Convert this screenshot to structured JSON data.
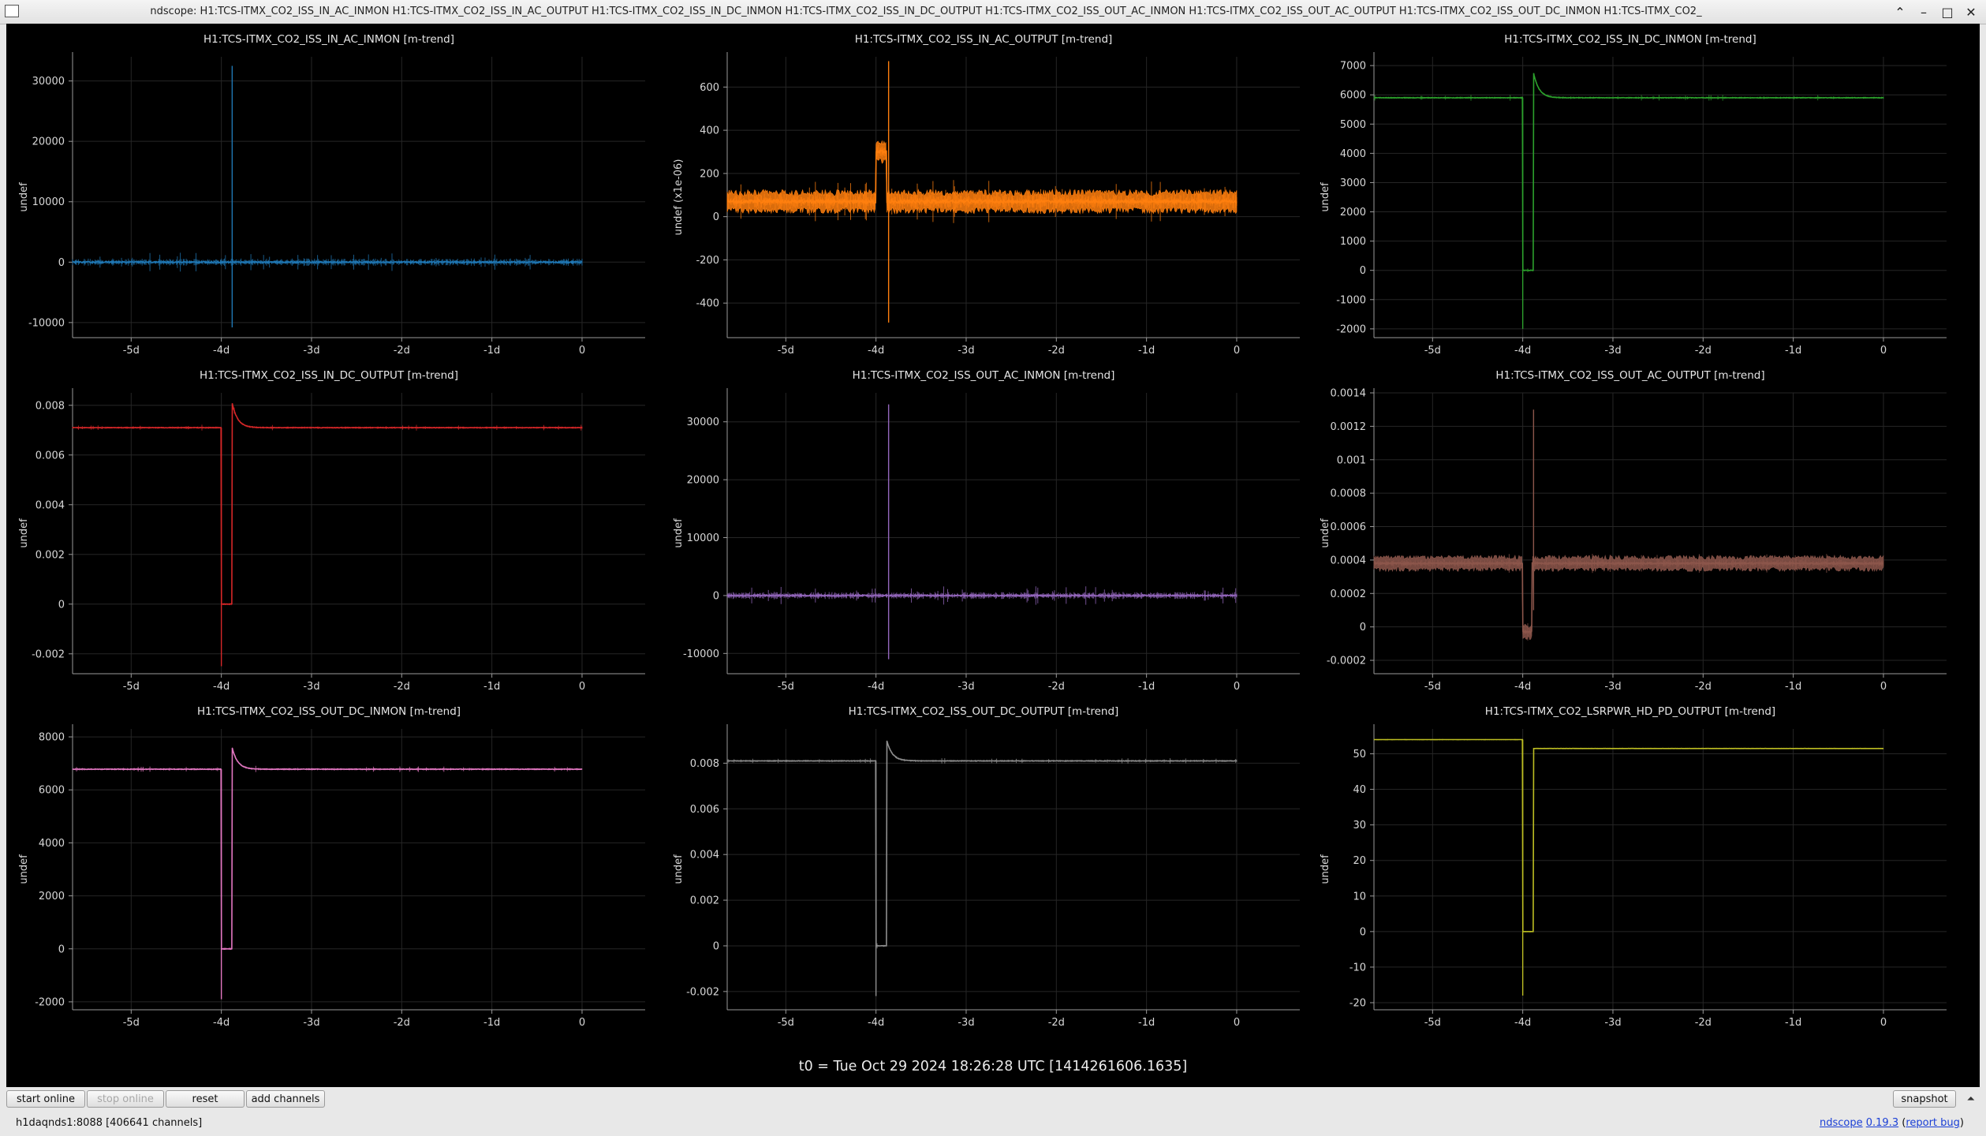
{
  "window": {
    "title": "ndscope: H1:TCS-ITMX_CO2_ISS_IN_AC_INMON H1:TCS-ITMX_CO2_ISS_IN_AC_OUTPUT H1:TCS-ITMX_CO2_ISS_IN_DC_INMON H1:TCS-ITMX_CO2_ISS_IN_DC_OUTPUT H1:TCS-ITMX_CO2_ISS_OUT_AC_INMON H1:TCS-ITMX_CO2_ISS_OUT_AC_OUTPUT H1:TCS-ITMX_CO2_ISS_OUT_DC_INMON H1:TCS-ITMX_CO2_",
    "controls": [
      "⌃",
      "–",
      "□",
      "✕"
    ]
  },
  "t0_label": "t0 = Tue Oct 29 2024 18:26:28 UTC [1414261606.1635]",
  "toolbar": {
    "start_online": "start online",
    "stop_online": "stop online",
    "reset": "reset",
    "add_channels": "add channels",
    "snapshot": "snapshot"
  },
  "status": "h1daqnds1:8088  [406641 channels]",
  "version": {
    "app": "ndscope",
    "number": "0.19.3",
    "report": "report bug"
  },
  "chart_data": [
    {
      "type": "line",
      "title": "H1:TCS-ITMX_CO2_ISS_IN_AC_INMON [m-trend]",
      "ylabel": "undef",
      "color": "#1f77b4",
      "xlim": [
        -5.65,
        0.7
      ],
      "ylim": [
        -12500,
        34000
      ],
      "x_ticks": [
        -5,
        -4,
        -3,
        -2,
        -1,
        0
      ],
      "x_tick_labels": [
        "-5d",
        "-4d",
        "-3d",
        "-2d",
        "-1d",
        "0"
      ],
      "y_ticks": [
        -10000,
        0,
        10000,
        20000,
        30000
      ],
      "y_tick_labels": [
        "-10000",
        "0",
        "10000",
        "20000",
        "30000"
      ],
      "series": [
        {
          "baseline": 0,
          "noise": 400,
          "band": 0,
          "events": [
            {
              "x": -3.88,
              "high": 32500,
              "low": -10800
            }
          ]
        }
      ]
    },
    {
      "type": "line",
      "title": "H1:TCS-ITMX_CO2_ISS_IN_AC_OUTPUT [m-trend]",
      "ylabel": "undef (x1e-06)",
      "color": "#ff7f0e",
      "xlim": [
        -5.65,
        0.7
      ],
      "ylim": [
        -560,
        740
      ],
      "x_ticks": [
        -5,
        -4,
        -3,
        -2,
        -1,
        0
      ],
      "x_tick_labels": [
        "-5d",
        "-4d",
        "-3d",
        "-2d",
        "-1d",
        "0"
      ],
      "y_ticks": [
        -400,
        -200,
        0,
        200,
        400,
        600
      ],
      "y_tick_labels": [
        "-400",
        "-200",
        "0",
        "200",
        "400",
        "600"
      ],
      "series": [
        {
          "baseline": 70,
          "noise": 25,
          "band": 35,
          "step": {
            "x0": -4.0,
            "x1": -3.88,
            "value": 300
          },
          "events": [
            {
              "x": -3.86,
              "high": 720,
              "low": -490
            }
          ]
        }
      ]
    },
    {
      "type": "line",
      "title": "H1:TCS-ITMX_CO2_ISS_IN_DC_INMON [m-trend]",
      "ylabel": "undef",
      "color": "#2ca02c",
      "xlim": [
        -5.65,
        0.7
      ],
      "ylim": [
        -2300,
        7300
      ],
      "x_ticks": [
        -5,
        -4,
        -3,
        -2,
        -1,
        0
      ],
      "x_tick_labels": [
        "-5d",
        "-4d",
        "-3d",
        "-2d",
        "-1d",
        "0"
      ],
      "y_ticks": [
        -2000,
        -1000,
        0,
        1000,
        2000,
        3000,
        4000,
        5000,
        6000,
        7000
      ],
      "y_tick_labels": [
        "-2000",
        "-1000",
        "0",
        "1000",
        "2000",
        "3000",
        "4000",
        "5000",
        "6000",
        "7000"
      ],
      "series": [
        {
          "baseline": 5900,
          "noise": 25,
          "band": 0,
          "step": {
            "x0": -4.0,
            "x1": -3.88,
            "value": 0
          },
          "overshoot": {
            "x": -3.88,
            "value": 6750
          },
          "events": [
            {
              "x": -4.0,
              "high": 5900,
              "low": -2000
            }
          ]
        }
      ]
    },
    {
      "type": "line",
      "title": "H1:TCS-ITMX_CO2_ISS_IN_DC_OUTPUT [m-trend]",
      "ylabel": "undef",
      "color": "#d62728",
      "xlim": [
        -5.65,
        0.7
      ],
      "ylim": [
        -0.0028,
        0.0085
      ],
      "x_ticks": [
        -5,
        -4,
        -3,
        -2,
        -1,
        0
      ],
      "x_tick_labels": [
        "-5d",
        "-4d",
        "-3d",
        "-2d",
        "-1d",
        "0"
      ],
      "y_ticks": [
        -0.002,
        0,
        0.002,
        0.004,
        0.006,
        0.008
      ],
      "y_tick_labels": [
        "-0.002",
        "0",
        "0.002",
        "0.004",
        "0.006",
        "0.008"
      ],
      "series": [
        {
          "baseline": 0.0071,
          "noise": 3e-05,
          "band": 0,
          "step": {
            "x0": -4.0,
            "x1": -3.88,
            "value": 0
          },
          "overshoot": {
            "x": -3.88,
            "value": 0.0081
          },
          "events": [
            {
              "x": -4.0,
              "high": 0.0071,
              "low": -0.0025
            }
          ]
        }
      ]
    },
    {
      "type": "line",
      "title": "H1:TCS-ITMX_CO2_ISS_OUT_AC_INMON [m-trend]",
      "ylabel": "undef",
      "color": "#9467bd",
      "xlim": [
        -5.65,
        0.7
      ],
      "ylim": [
        -13500,
        35000
      ],
      "x_ticks": [
        -5,
        -4,
        -3,
        -2,
        -1,
        0
      ],
      "x_tick_labels": [
        "-5d",
        "-4d",
        "-3d",
        "-2d",
        "-1d",
        "0"
      ],
      "y_ticks": [
        -10000,
        0,
        10000,
        20000,
        30000
      ],
      "y_tick_labels": [
        "-10000",
        "0",
        "10000",
        "20000",
        "30000"
      ],
      "series": [
        {
          "baseline": 0,
          "noise": 400,
          "band": 0,
          "events": [
            {
              "x": -3.86,
              "high": 33000,
              "low": -11000
            }
          ]
        }
      ]
    },
    {
      "type": "line",
      "title": "H1:TCS-ITMX_CO2_ISS_OUT_AC_OUTPUT [m-trend]",
      "ylabel": "undef",
      "color": "#8c564b",
      "xlim": [
        -5.65,
        0.7
      ],
      "ylim": [
        -0.00028,
        0.0014
      ],
      "x_ticks": [
        -5,
        -4,
        -3,
        -2,
        -1,
        0
      ],
      "x_tick_labels": [
        "-5d",
        "-4d",
        "-3d",
        "-2d",
        "-1d",
        "0"
      ],
      "y_ticks": [
        -0.0002,
        0,
        0.0002,
        0.0004,
        0.0006,
        0.0008,
        0.001,
        0.0012,
        0.0014
      ],
      "y_tick_labels": [
        "-0.0002",
        "0",
        "0.0002",
        "0.0004",
        "0.0006",
        "0.0008",
        "0.001",
        "0.0012",
        "0.0014"
      ],
      "series": [
        {
          "baseline": 0.00038,
          "noise": 1.5e-05,
          "band": 3e-05,
          "step": {
            "x0": -4.0,
            "x1": -3.9,
            "value": -3e-05
          },
          "events": [
            {
              "x": -3.88,
              "high": 0.0013,
              "low": 0.0001
            }
          ]
        }
      ]
    },
    {
      "type": "line",
      "title": "H1:TCS-ITMX_CO2_ISS_OUT_DC_INMON [m-trend]",
      "ylabel": "undef",
      "color": "#e377c2",
      "xlim": [
        -5.65,
        0.7
      ],
      "ylim": [
        -2300,
        8300
      ],
      "x_ticks": [
        -5,
        -4,
        -3,
        -2,
        -1,
        0
      ],
      "x_tick_labels": [
        "-5d",
        "-4d",
        "-3d",
        "-2d",
        "-1d",
        "0"
      ],
      "y_ticks": [
        -2000,
        0,
        2000,
        4000,
        6000,
        8000
      ],
      "y_tick_labels": [
        "-2000",
        "0",
        "2000",
        "4000",
        "6000",
        "8000"
      ],
      "series": [
        {
          "baseline": 6780,
          "noise": 30,
          "band": 0,
          "step": {
            "x0": -4.0,
            "x1": -3.88,
            "value": 0
          },
          "overshoot": {
            "x": -3.88,
            "value": 7600
          },
          "events": [
            {
              "x": -4.0,
              "high": 6780,
              "low": -1900
            }
          ]
        }
      ]
    },
    {
      "type": "line",
      "title": "H1:TCS-ITMX_CO2_ISS_OUT_DC_OUTPUT [m-trend]",
      "ylabel": "undef",
      "color": "#8f8f8f",
      "xlim": [
        -5.65,
        0.7
      ],
      "ylim": [
        -0.0028,
        0.0095
      ],
      "x_ticks": [
        -5,
        -4,
        -3,
        -2,
        -1,
        0
      ],
      "x_tick_labels": [
        "-5d",
        "-4d",
        "-3d",
        "-2d",
        "-1d",
        "0"
      ],
      "y_ticks": [
        -0.002,
        0,
        0.002,
        0.004,
        0.006,
        0.008
      ],
      "y_tick_labels": [
        "-0.002",
        "0",
        "0.002",
        "0.004",
        "0.006",
        "0.008"
      ],
      "series": [
        {
          "baseline": 0.0081,
          "noise": 3e-05,
          "band": 0,
          "step": {
            "x0": -4.0,
            "x1": -3.88,
            "value": 0
          },
          "overshoot": {
            "x": -3.88,
            "value": 0.009
          },
          "events": [
            {
              "x": -4.0,
              "high": 0.0081,
              "low": -0.0022
            }
          ]
        }
      ]
    },
    {
      "type": "line",
      "title": "H1:TCS-ITMX_CO2_LSRPWR_HD_PD_OUTPUT [m-trend]",
      "ylabel": "undef",
      "color": "#bcbd22",
      "xlim": [
        -5.65,
        0.7
      ],
      "ylim": [
        -22,
        57
      ],
      "x_ticks": [
        -5,
        -4,
        -3,
        -2,
        -1,
        0
      ],
      "x_tick_labels": [
        "-5d",
        "-4d",
        "-3d",
        "-2d",
        "-1d",
        "0"
      ],
      "y_ticks": [
        -20,
        -10,
        0,
        10,
        20,
        30,
        40,
        50
      ],
      "y_tick_labels": [
        "-20",
        "-10",
        "0",
        "10",
        "20",
        "30",
        "40",
        "50"
      ],
      "series": [
        {
          "baseline": 54,
          "baseline_after": 51.5,
          "noise": 0.05,
          "band": 0,
          "step": {
            "x0": -4.0,
            "x1": -3.88,
            "value": 0
          },
          "events": [
            {
              "x": -4.0,
              "high": 54,
              "low": -18
            }
          ]
        }
      ]
    }
  ]
}
